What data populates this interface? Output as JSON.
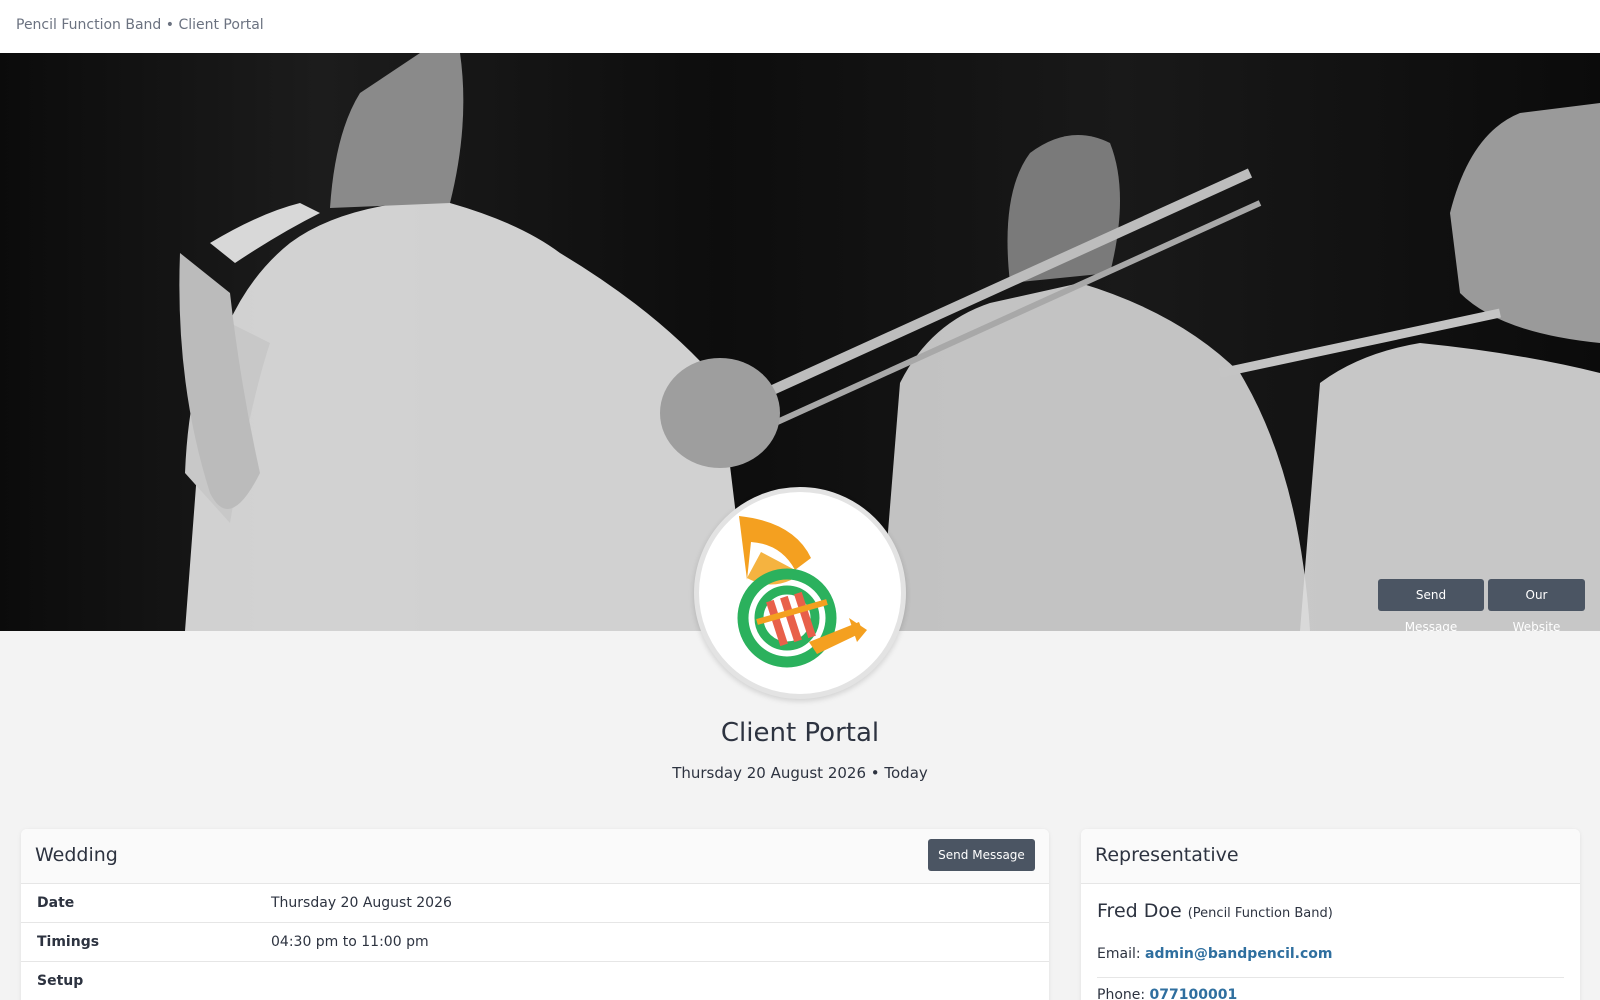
{
  "header": {
    "brand": "Pencil Function Band • Client Portal"
  },
  "hero": {
    "send_message_label": "Send Message",
    "website_label": "Our Website"
  },
  "logo": {
    "icon": "french-horn-icon",
    "colors": {
      "horn": "#f4a020",
      "ring": "#2bb15d",
      "valves": "#e8604a"
    }
  },
  "portal": {
    "title": "Client Portal",
    "subtitle": "Thursday 20 August 2026 • Today"
  },
  "event": {
    "title": "Wedding",
    "send_message_label": "Send Message",
    "rows": [
      {
        "label": "Date",
        "value": "Thursday 20 August 2026"
      },
      {
        "label": "Timings",
        "value": "04:30 pm to 11:00 pm"
      },
      {
        "label": "Setup",
        "value": ""
      }
    ]
  },
  "representative": {
    "title": "Representative",
    "name": "Fred Doe",
    "org": "(Pencil Function Band)",
    "email_label": "Email:",
    "email": "admin@bandpencil.com",
    "phone_label": "Phone:",
    "phone": "077100001"
  },
  "colors": {
    "button": "#4b5563",
    "link": "#2f6f9f",
    "background": "#f3f3f3"
  }
}
